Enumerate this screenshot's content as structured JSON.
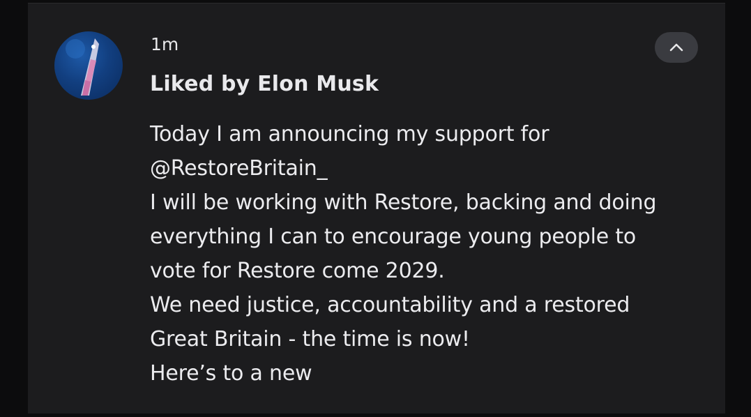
{
  "notification": {
    "timestamp": "1m",
    "title": "Liked by Elon Musk",
    "body_lines": [
      "Today I am announcing my support for",
      "@RestoreBritain_",
      "I will be working with Restore, backing and doing",
      "everything I can to encourage young people to",
      "vote for Restore come 2029.",
      "We need justice, accountability and a restored",
      "Great Britain - the time is now!",
      "Here’s to a new"
    ],
    "avatar_icon": "rocket-avatar-icon",
    "collapse_icon": "chevron-up-icon"
  },
  "colors": {
    "background": "#0c0c0d",
    "card": "#1c1c1e",
    "text": "#ececef",
    "button": "#3a3b40"
  }
}
